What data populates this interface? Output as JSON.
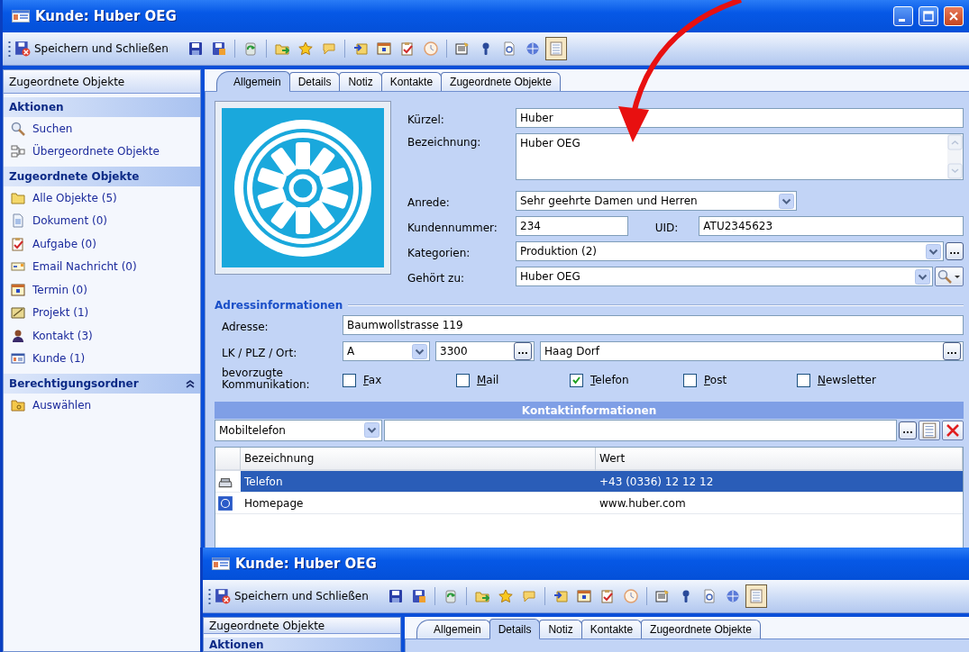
{
  "main_window": {
    "title": "Kunde: Huber OEG",
    "toolbar": {
      "save_label": "Speichern und Schließen",
      "tools": [
        {
          "kind": "save",
          "pressed": false
        },
        {
          "kind": "save-as",
          "pressed": false
        },
        {
          "kind": "separator"
        },
        {
          "kind": "refresh",
          "pressed": false
        },
        {
          "kind": "separator"
        },
        {
          "kind": "folder-arrow",
          "pressed": false
        },
        {
          "kind": "star",
          "pressed": false
        },
        {
          "kind": "bubble",
          "pressed": false
        },
        {
          "kind": "separator"
        },
        {
          "kind": "arrow-folder",
          "pressed": false
        },
        {
          "kind": "calendar",
          "pressed": false
        },
        {
          "kind": "clipboard",
          "pressed": false
        },
        {
          "kind": "clock",
          "pressed": false
        },
        {
          "kind": "separator"
        },
        {
          "kind": "doc-edit",
          "pressed": false
        },
        {
          "kind": "pin",
          "pressed": false
        },
        {
          "kind": "page-search",
          "pressed": false
        },
        {
          "kind": "globe",
          "pressed": false
        },
        {
          "kind": "list",
          "pressed": true
        }
      ]
    },
    "sidebar": {
      "title": "Zugeordnete Objekte",
      "sections": [
        {
          "title": "Aktionen",
          "items": [
            {
              "kind": "search",
              "label": "Suchen"
            },
            {
              "kind": "hierarchy",
              "label": "Übergeordnete Objekte"
            }
          ]
        },
        {
          "title": "Zugeordnete Objekte",
          "items": [
            {
              "kind": "folder",
              "label": "Alle Objekte (5)"
            },
            {
              "kind": "document",
              "label": "Dokument (0)"
            },
            {
              "kind": "clipboard",
              "label": "Aufgabe (0)"
            },
            {
              "kind": "mail",
              "label": "Email Nachricht (0)"
            },
            {
              "kind": "calendar",
              "label": "Termin (0)"
            },
            {
              "kind": "project",
              "label": "Projekt (1)"
            },
            {
              "kind": "person",
              "label": "Kontakt (3)"
            },
            {
              "kind": "card",
              "label": "Kunde (1)"
            }
          ]
        },
        {
          "title": "Berechtigungsordner",
          "expanded": true,
          "items": [
            {
              "kind": "folder-key",
              "label": "Auswählen"
            }
          ]
        }
      ]
    },
    "tabs": [
      {
        "label": "Allgemein",
        "selected": true
      },
      {
        "label": "Details",
        "selected": false
      },
      {
        "label": "Notiz",
        "selected": false
      },
      {
        "label": "Kontakte",
        "selected": false
      },
      {
        "label": "Zugeordnete Objekte",
        "selected": false
      }
    ],
    "form": {
      "kuerzel": {
        "label": "Kürzel:",
        "value": "Huber"
      },
      "bezeichnung": {
        "label": "Bezeichnung:",
        "value": "Huber OEG"
      },
      "anrede": {
        "label": "Anrede:",
        "value": "Sehr geehrte Damen und Herren"
      },
      "kundennummer": {
        "label": "Kundennummer:",
        "value": "234"
      },
      "uid": {
        "label": "UID:",
        "value": "ATU2345623"
      },
      "kategorien": {
        "label": "Kategorien:",
        "value": "Produktion (2)",
        "button": "..."
      },
      "gehoert_zu": {
        "label": "Gehört zu:",
        "value": "Huber OEG"
      }
    },
    "address": {
      "title": "Adressinformationen",
      "adresse": {
        "label": "Adresse:",
        "value": "Baumwollstrasse 119"
      },
      "location": {
        "label": "LK / PLZ / Ort:",
        "country": "A",
        "zip": "3300",
        "zip_button": "...",
        "city": "Haag Dorf",
        "city_button": "..."
      },
      "communication": {
        "label": "bevorzugte Kommunikation:",
        "options": [
          {
            "label": "Fax",
            "checked": false
          },
          {
            "label": "Mail",
            "checked": false
          },
          {
            "label": "Telefon",
            "checked": true
          },
          {
            "label": "Post",
            "checked": false
          },
          {
            "label": "Newsletter",
            "checked": false
          }
        ]
      }
    },
    "contacts": {
      "title": "Kontaktinformationen",
      "type": "Mobiltelefon",
      "button": "...",
      "columns": [
        "Bezeichnung",
        "Wert"
      ],
      "rows": [
        {
          "kind": "phone",
          "name": "Telefon",
          "value": "+43 (0336) 12 12 12",
          "selected": true
        },
        {
          "kind": "web",
          "name": "Homepage",
          "value": "www.huber.com",
          "selected": false
        }
      ]
    }
  },
  "second_window": {
    "title": "Kunde: Huber OEG",
    "save_label": "Speichern und Schließen",
    "sidebar_title": "Zugeordnete Objekte",
    "sidebar_section": "Aktionen",
    "tabs": [
      {
        "label": "Allgemein",
        "selected": false
      },
      {
        "label": "Details",
        "selected": true
      },
      {
        "label": "Notiz",
        "selected": false
      },
      {
        "label": "Kontakte",
        "selected": false
      },
      {
        "label": "Zugeordnete Objekte",
        "selected": false
      }
    ]
  }
}
